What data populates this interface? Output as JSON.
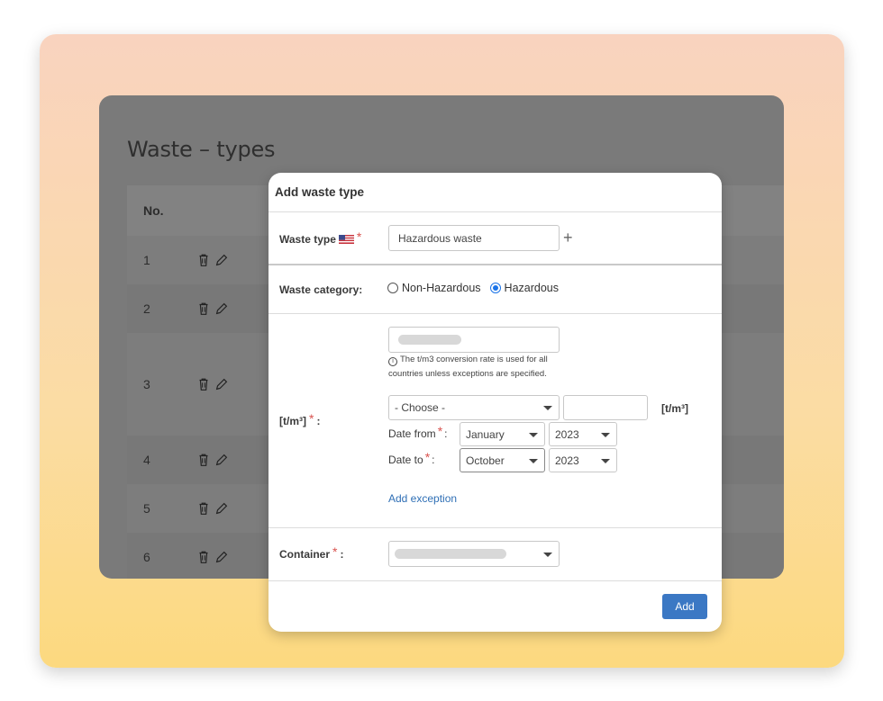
{
  "background": {
    "title": "Waste – types",
    "table_header_no": "No.",
    "rows": [
      "1",
      "2",
      "3",
      "4",
      "5",
      "6"
    ]
  },
  "modal": {
    "title": "Add waste type",
    "waste_type_label": "Waste type",
    "waste_type_value": "Hazardous waste",
    "add_icon": "+",
    "waste_category_label": "Waste category:",
    "category_options": [
      "Non-Hazardous",
      "Hazardous"
    ],
    "category_selected": "Hazardous",
    "conversion_label": "[t/m³]",
    "conversion_label_suffix": ":",
    "hint_text": "The t/m3 conversion rate is used for all countries unless exceptions are specified.",
    "choose_placeholder": "- Choose -",
    "unit_label": "[t/m³]",
    "date_from_label": "Date from",
    "date_to_label": "Date to",
    "date_from_month": "January",
    "date_from_year": "2023",
    "date_to_month": "October",
    "date_to_year": "2023",
    "add_exception": "Add exception",
    "container_label": "Container",
    "add_button": "Add"
  },
  "colors": {
    "accent": "#3b78c4",
    "link": "#2f6fb5",
    "required": "#d9534f"
  }
}
